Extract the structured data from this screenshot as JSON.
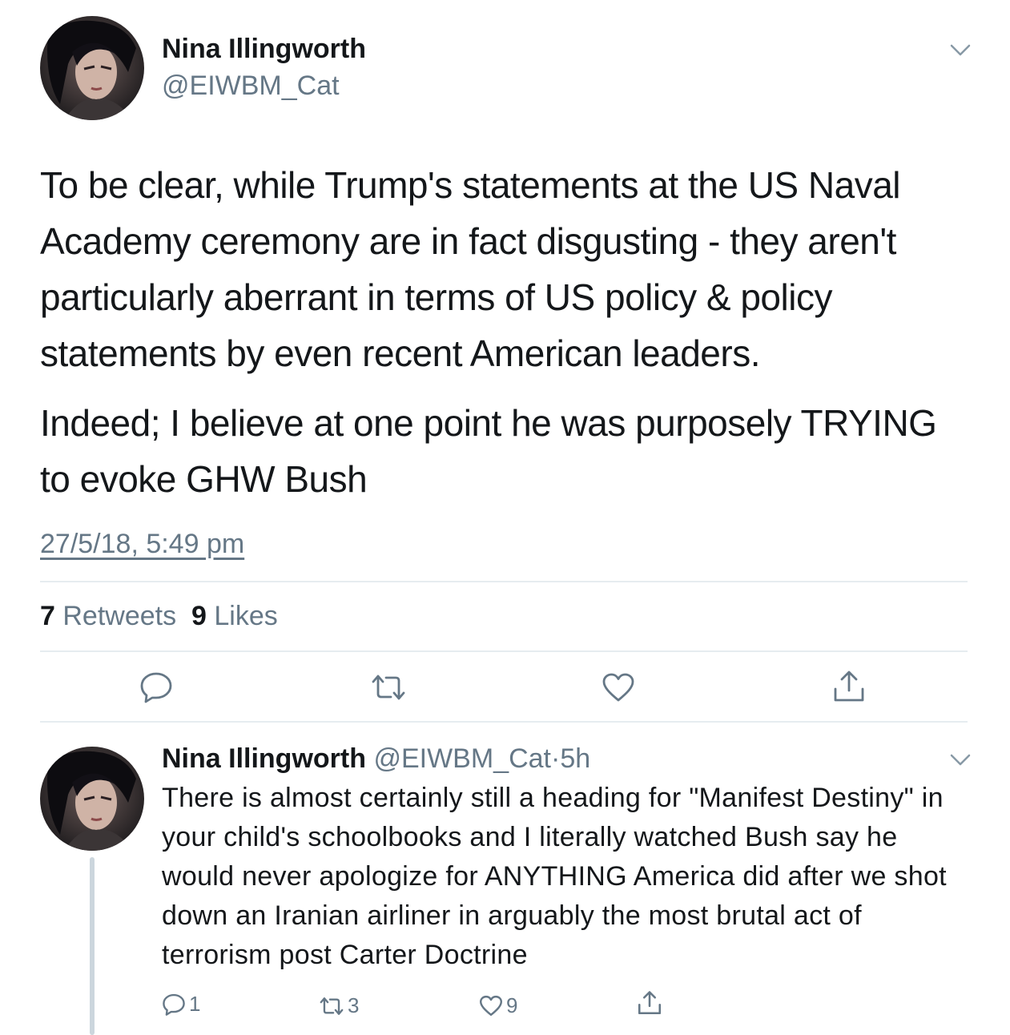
{
  "main_tweet": {
    "author_name": "Nina Illingworth",
    "author_handle": "@EIWBM_Cat",
    "paragraphs": [
      "To be clear, while Trump's statements at the US Naval Academy ceremony are in fact disgusting - they aren't particularly aberrant in terms of US policy & policy statements by even recent American leaders.",
      "Indeed; I believe at one point he was purposely TRYING to evoke GHW Bush"
    ],
    "timestamp": "27/5/18, 5:49 pm",
    "retweet_count": "7",
    "retweet_label": "Retweets",
    "like_count": "9",
    "like_label": "Likes",
    "actions": [
      "reply-icon",
      "retweet-icon",
      "like-icon",
      "share-icon"
    ]
  },
  "reply_tweet": {
    "author_name": "Nina Illingworth",
    "author_handle": "@EIWBM_Cat",
    "separator": "·",
    "age": "5h",
    "text": "There is almost certainly still a heading for \"Manifest Destiny\" in your child's schoolbooks and I literally watched Bush say he would never apologize for ANYTHING America did after we shot down an Iranian airliner in arguably the most brutal act of terrorism post Carter Doctrine",
    "reply_count": "1",
    "retweet_count": "3",
    "like_count": "9"
  },
  "colors": {
    "text": "#14171a",
    "secondary": "#657786",
    "divider": "#e6ecf0",
    "icon": "#657786"
  }
}
